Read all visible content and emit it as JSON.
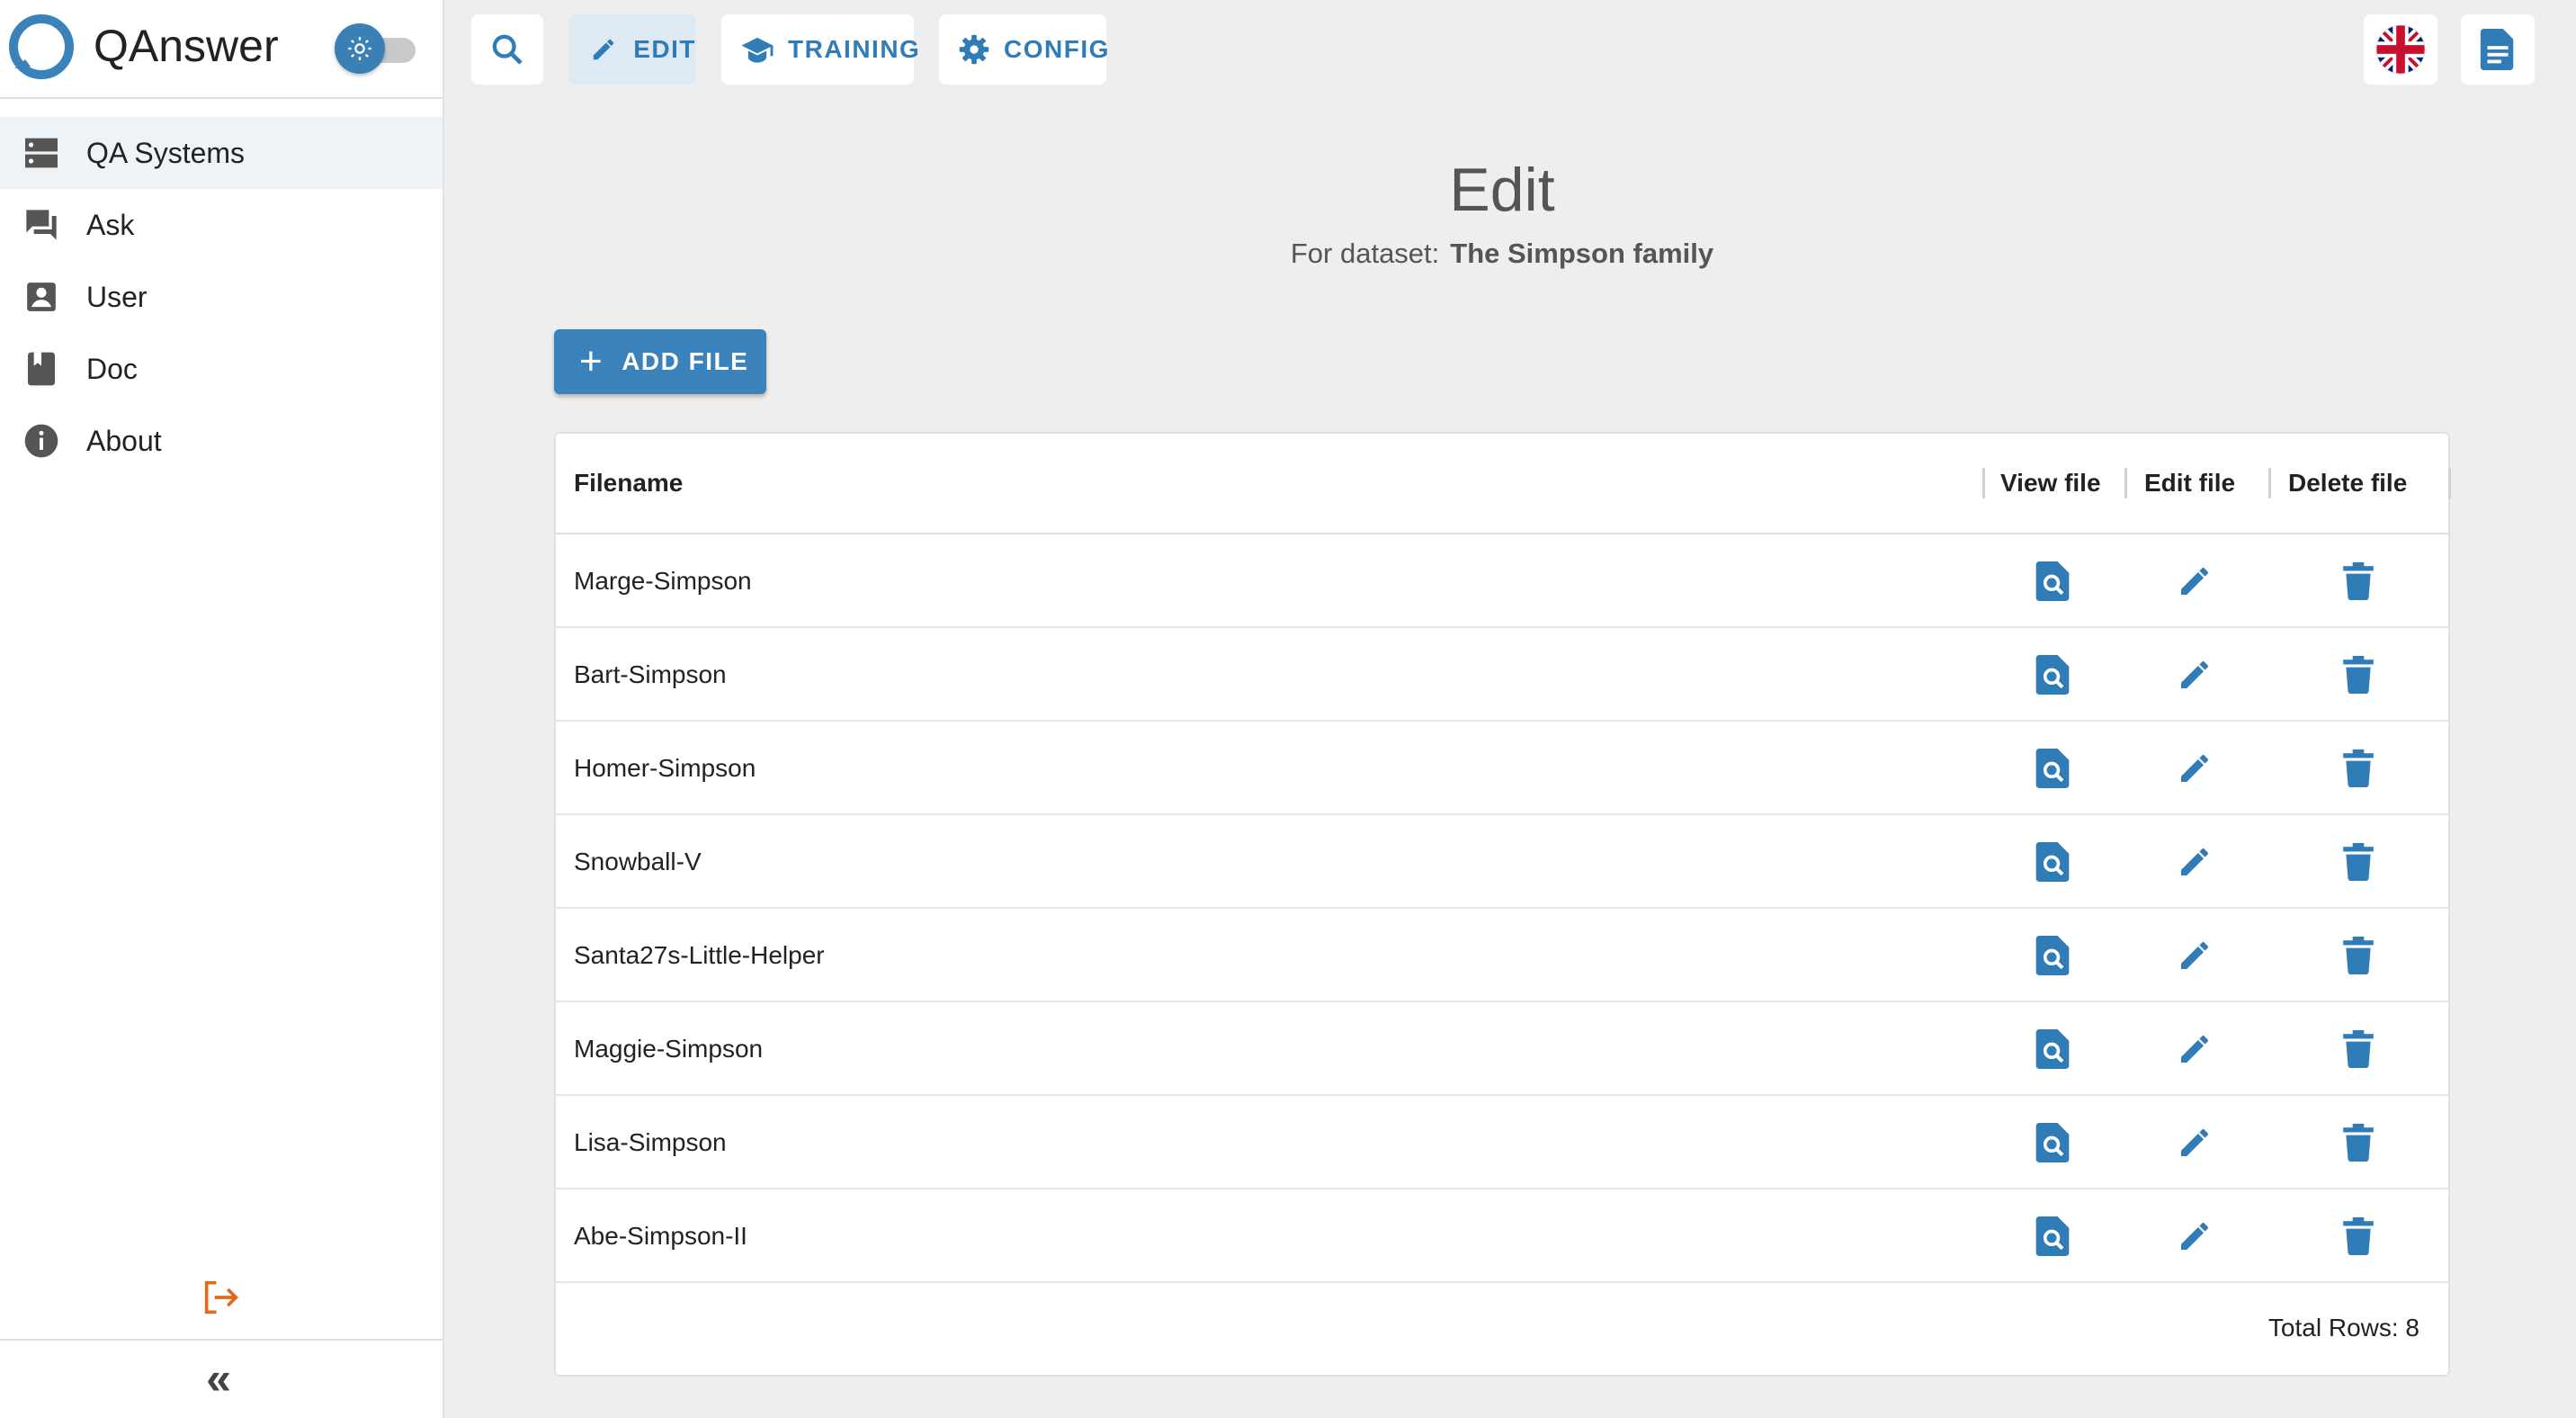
{
  "app": {
    "name": "QAnswer"
  },
  "sidebar": {
    "items": [
      {
        "label": "QA Systems",
        "icon": "server-icon",
        "active": true
      },
      {
        "label": "Ask",
        "icon": "forum-icon",
        "active": false
      },
      {
        "label": "User",
        "icon": "account-box-icon",
        "active": false
      },
      {
        "label": "Doc",
        "icon": "book-icon",
        "active": false
      },
      {
        "label": "About",
        "icon": "info-icon",
        "active": false
      }
    ],
    "collapse_label": "«"
  },
  "toolbar": {
    "edit_label": "EDIT",
    "training_label": "TRAINING",
    "config_label": "CONFIG"
  },
  "header": {
    "title": "Edit",
    "subtitle_prefix": "For dataset:",
    "dataset_name": "The Simpson family"
  },
  "add_file_label": "ADD FILE",
  "table": {
    "columns": [
      "Filename",
      "View file",
      "Edit file",
      "Delete file"
    ],
    "rows": [
      "Marge-Simpson",
      "Bart-Simpson",
      "Homer-Simpson",
      "Snowball-V",
      "Santa27s-Little-Helper",
      "Maggie-Simpson",
      "Lisa-Simpson",
      "Abe-Simpson-II"
    ],
    "total_rows_text": "Total Rows: 8"
  },
  "colors": {
    "accent": "#3a82bb",
    "logout": "#e06a1b",
    "background": "#eeeeee"
  }
}
